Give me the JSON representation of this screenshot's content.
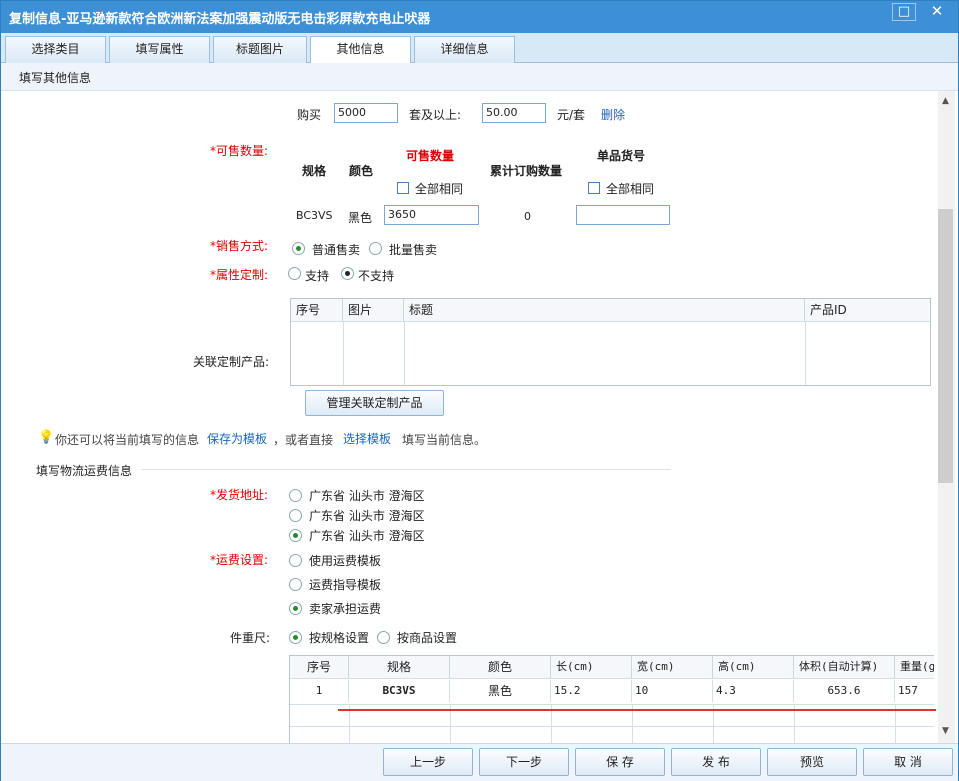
{
  "window": {
    "title": "复制信息-亚马逊新款符合欧洲新法案加强震动版无电击彩屏款充电止吠器",
    "max_glyph": "□",
    "close_glyph": "✕"
  },
  "tabs": [
    {
      "label": "选择类目",
      "active": false
    },
    {
      "label": "填写属性",
      "active": false
    },
    {
      "label": "标题图片",
      "active": false
    },
    {
      "label": "其他信息",
      "active": true
    },
    {
      "label": "详细信息",
      "active": false
    }
  ],
  "subheader": "填写其他信息",
  "tier": {
    "buy": "购买",
    "qty_value": "5000",
    "unit_above": "套及以上:",
    "price_value": "50.00",
    "price_unit": "元/套",
    "delete": "删除"
  },
  "stock": {
    "label": "可售数量:",
    "col_spec": "规格",
    "col_color": "颜色",
    "col_qty": "可售数量",
    "col_cum": "累计订购数量",
    "col_sku": "单品货号",
    "same_all": "全部相同",
    "row": {
      "spec": "BC3VS",
      "color": "黑色",
      "qty": "3650",
      "cum": "0",
      "sku": ""
    }
  },
  "sale_mode": {
    "label": "销售方式:",
    "opt1": "普通售卖",
    "opt2": "批量售卖"
  },
  "custom": {
    "label": "属性定制:",
    "opt1": "支持",
    "opt2": "不支持"
  },
  "related": {
    "label": "关联定制产品:",
    "headers": [
      "序号",
      "图片",
      "标题",
      "产品ID"
    ],
    "manage_button": "管理关联定制产品"
  },
  "template_tip": {
    "icon": "lightbulb-icon",
    "text1": "你还可以将当前填写的信息",
    "save_link": "保存为模板",
    "text2": "，或者直接",
    "choose_link": "选择模板",
    "text3": "填写当前信息。"
  },
  "logistics": {
    "section": "填写物流运费信息"
  },
  "ship_from": {
    "label": "发货地址:",
    "options": [
      "广东省 汕头市 澄海区",
      "广东省 汕头市 澄海区",
      "广东省 汕头市 澄海区"
    ]
  },
  "freight": {
    "label": "运费设置:",
    "options": [
      "使用运费模板",
      "运费指导模板",
      "卖家承担运费"
    ]
  },
  "weight": {
    "label": "件重尺:",
    "opt1": "按规格设置",
    "opt2": "按商品设置",
    "headers": [
      "序号",
      "规格",
      "颜色",
      "长(cm)",
      "宽(cm)",
      "高(cm)",
      "体积(自动计算)",
      "重量(g"
    ],
    "row": [
      "1",
      "BC3VS",
      "黑色",
      "15.2",
      "10",
      "4.3",
      "653.6",
      "157"
    ]
  },
  "footer": {
    "prev": "上一步",
    "next": "下一步",
    "save": "保 存",
    "publish": "发 布",
    "preview": "预览",
    "cancel": "取 消"
  },
  "colors": {
    "accent": "#3d8fd6",
    "required": "#dd0000",
    "link": "#1a66b8",
    "annotation": "#e03030"
  }
}
